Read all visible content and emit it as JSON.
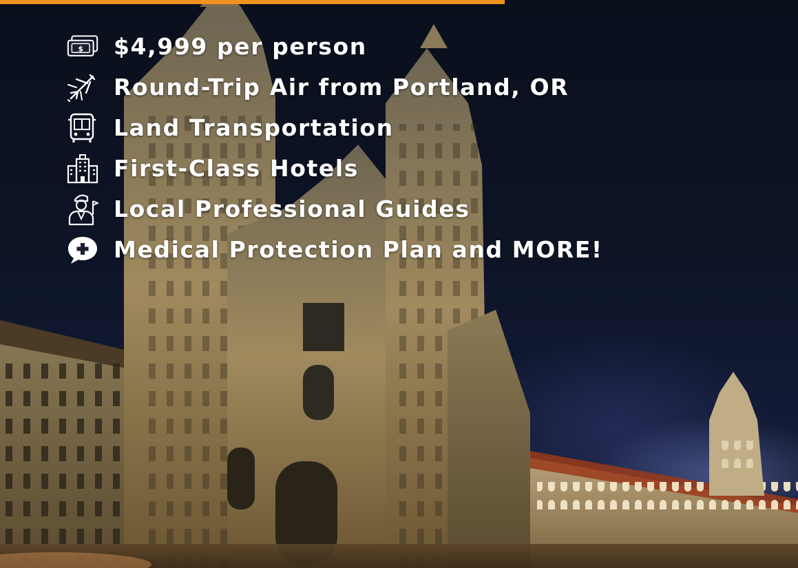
{
  "accent_color": "#f0921e",
  "features": [
    {
      "icon": "money-icon",
      "label": "$4,999 per person"
    },
    {
      "icon": "airplane-icon",
      "label": "Round-Trip Air from Portland, OR"
    },
    {
      "icon": "bus-icon",
      "label": "Land Transportation"
    },
    {
      "icon": "hotel-icon",
      "label": "First-Class Hotels"
    },
    {
      "icon": "tour-guide-icon",
      "label": "Local Professional Guides"
    },
    {
      "icon": "medical-chat-icon",
      "label": "Medical Protection Plan and MORE!"
    }
  ],
  "background": {
    "subject": "cathedral-at-night-photo"
  }
}
